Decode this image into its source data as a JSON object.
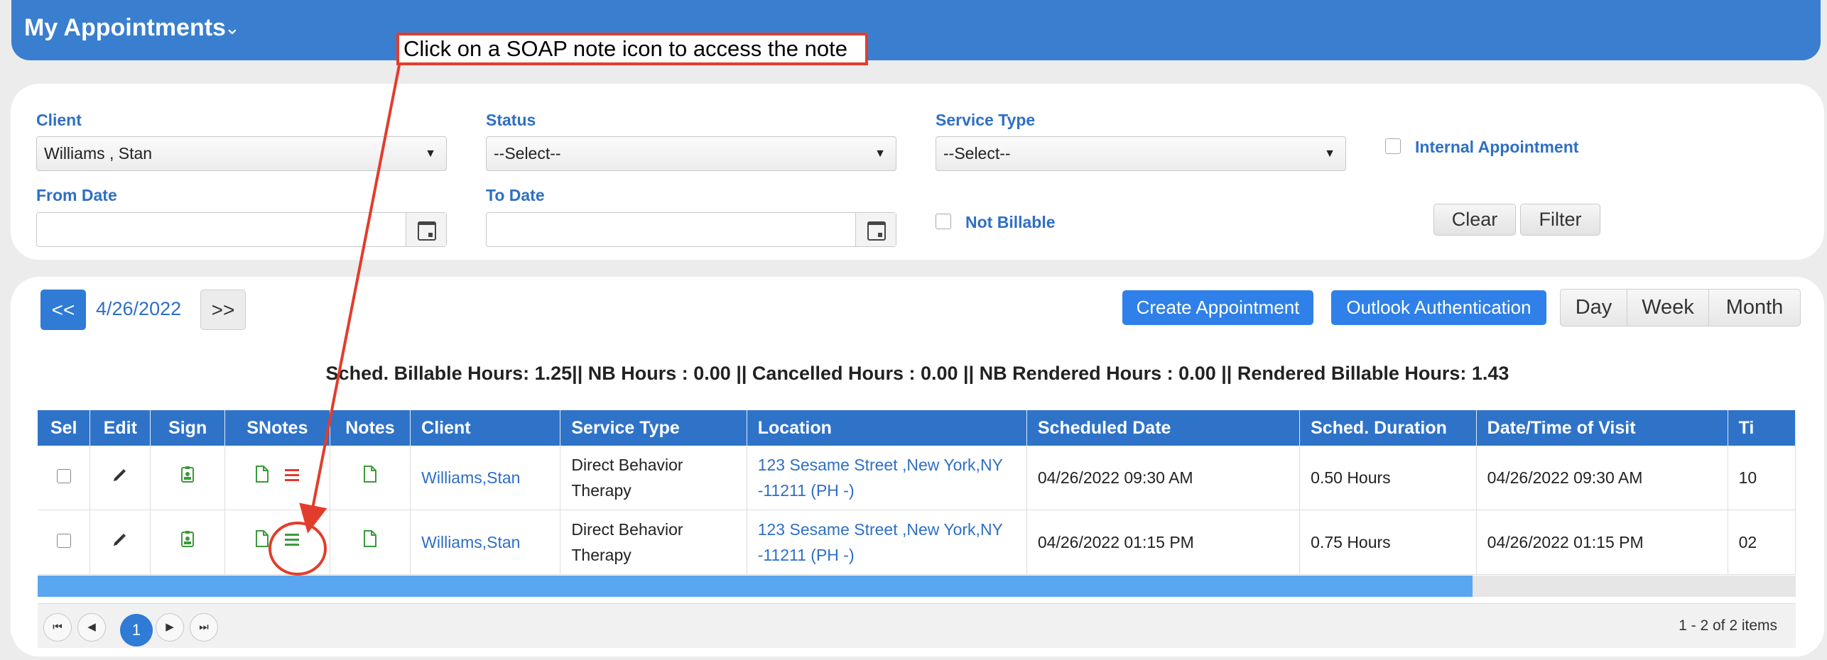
{
  "header": {
    "title": "My Appointments"
  },
  "callout": {
    "text": "Click on a SOAP note icon to access the note"
  },
  "filters": {
    "client_label": "Client",
    "client_value": "Williams , Stan",
    "status_label": "Status",
    "status_value": "--Select--",
    "service_type_label": "Service Type",
    "service_type_value": "--Select--",
    "internal_label": "Internal Appointment",
    "from_date_label": "From Date",
    "from_date_value": "",
    "to_date_label": "To Date",
    "to_date_value": "",
    "not_billable_label": "Not Billable",
    "clear_label": "Clear",
    "filter_label": "Filter"
  },
  "toolbar": {
    "prev_label": "<<",
    "date": "4/26/2022",
    "next_label": ">>",
    "create_label": "Create Appointment",
    "outlook_label": "Outlook Authentication",
    "views": [
      "Day",
      "Week",
      "Month"
    ]
  },
  "summary": "Sched. Billable Hours: 1.25|| NB Hours : 0.00 || Cancelled Hours : 0.00 || NB Rendered Hours : 0.00 || Rendered Billable Hours: 1.43",
  "grid": {
    "columns": [
      "Sel",
      "Edit",
      "Sign",
      "SNotes",
      "Notes",
      "Client",
      "Service Type",
      "Location",
      "Scheduled Date",
      "Sched. Duration",
      "Date/Time of Visit",
      "Ti"
    ],
    "rows": [
      {
        "client": "Williams,Stan",
        "service_line1": "Direct Behavior",
        "service_line2": "Therapy",
        "location_line1": "123 Sesame Street ,New York,NY",
        "location_line2": "-11211 (PH -)",
        "scheduled": "04/26/2022 09:30 AM",
        "duration": "0.50 Hours",
        "visit": "04/26/2022 09:30 AM",
        "time": "10"
      },
      {
        "client": "Williams,Stan",
        "service_line1": "Direct Behavior",
        "service_line2": "Therapy",
        "location_line1": "123 Sesame Street ,New York,NY",
        "location_line2": "-11211 (PH -)",
        "scheduled": "04/26/2022 01:15 PM",
        "duration": "0.75 Hours",
        "visit": "04/26/2022 01:15 PM",
        "time": "02"
      }
    ]
  },
  "pager": {
    "current": "1",
    "info": "1 - 2 of 2 items"
  },
  "colors": {
    "header": "#3a7fcf",
    "accent": "#2f80e8",
    "annotation": "#e23d2c",
    "icon_green": "#3c9a3c",
    "icon_red": "#e03a30"
  },
  "icons": [
    "pencil-icon",
    "sign-icon",
    "document-icon",
    "list-icon",
    "calendar-icon",
    "chevron-down-icon"
  ]
}
